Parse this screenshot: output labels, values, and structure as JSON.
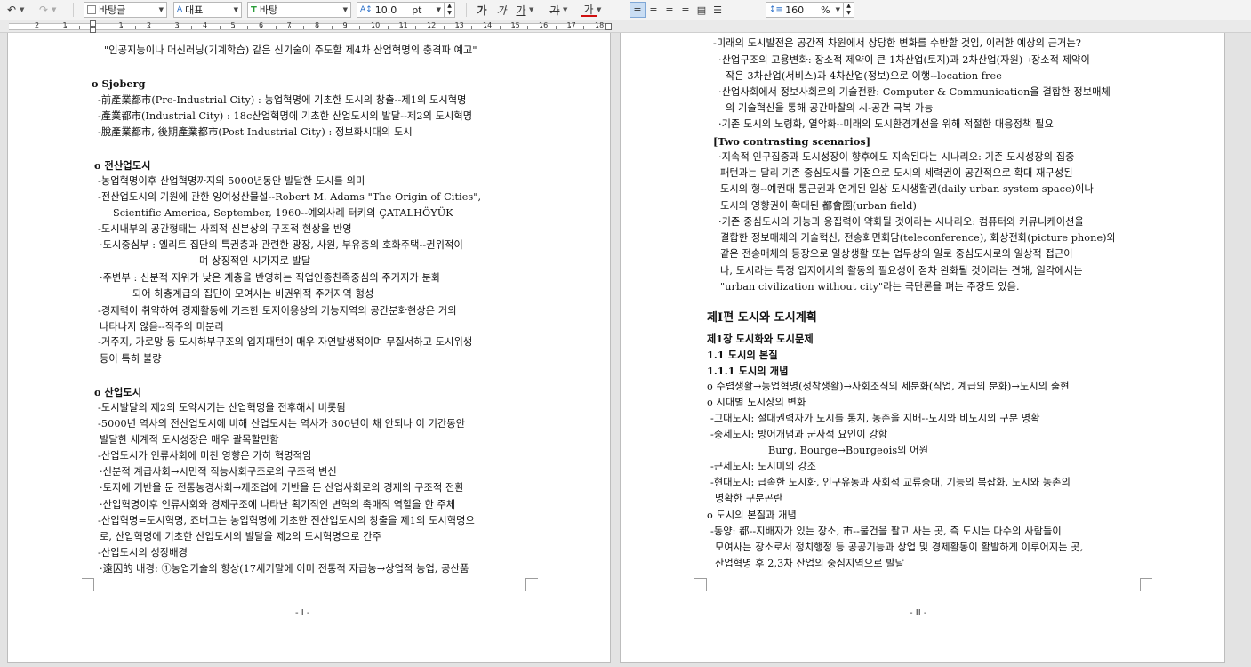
{
  "toolbar": {
    "undo_icon": "undo-icon",
    "redo_icon": "redo-icon",
    "style": "바탕글",
    "font_lang": "대표",
    "font_name": "바탕",
    "font_size": "10.0",
    "font_unit": "pt",
    "bold_label": "가",
    "italic_label": "가",
    "underline_label": "가",
    "strike_label": "가",
    "color_label": "가",
    "line_spacing": "160",
    "line_spacing_unit": "%"
  },
  "ruler": {
    "numbers": [
      "2",
      "1",
      "1",
      "2",
      "3",
      "4",
      "5",
      "6",
      "7",
      "8",
      "9",
      "10",
      "11",
      "12",
      "13",
      "14",
      "15",
      "16",
      "17",
      "18"
    ]
  },
  "page1": {
    "lines": [
      "\"인공지능이나 머신러닝(기계학습) 같은 신기술이 주도할 제4차 산업혁명의 충격파 예고\"",
      "o Sjoberg",
      "-前產業都市(Pre-Industrial City) : 농업혁명에 기초한 도시의 창출--제1의 도시혁명",
      "-產業都市(Industrial City) : 18c산업혁명에 기초한 산업도시의 발달--제2의 도시혁명",
      "-脫產業都市, 後期產業都市(Post Industrial City) : 정보화시대의 도시",
      "o 전산업도시",
      "-농업혁명이후 산업혁명까지의 5000년동안 발달한 도시를 의미",
      "-전산업도시의 기원에 관한 잉여생산물설--Robert M. Adams \"The Origin of Cities\",",
      "Scientific America, September, 1960--예외사례 터키의 ÇATALHÖYÜK",
      "-도시내부의 공간형태는 사회적 신분상의 구조적 현상을 반영",
      "·도시중심부 : 엘리트 집단의 특권층과 관련한 광장, 사원, 부유층의 호화주택--권위적이",
      "며 상징적인 시가지로 발달",
      "·주변부 : 신분적 지위가 낮은 계층을 반영하는 직업인종친족중심의 주거지가 분화",
      "되어 하층계급의 집단이 모여사는 비권위적 주거지역 형성",
      "-경제력이 취약하여 경제활동에 기초한 토지이용상의 기능지역의 공간분화현상은 거의",
      "나타나지 않음--직주의 미분리",
      "-거주지, 가로망 등 도시하부구조의 입지패턴이 매우 자연발생적이며 무질서하고 도시위생",
      "등이 특히 불량",
      "o 산업도시",
      "-도시발달의 제2의 도약시기는 산업혁명을 전후해서 비롯됨",
      "-5000년 역사의 전산업도시에 비해 산업도시는 역사가 300년이 채 안되나 이 기간동안",
      "발달한 세계적 도시성장은 매우 괄목할만함",
      "-산업도시가 인류사회에 미친 영향은 가히 혁명적임",
      "·신분적 계급사회→시민적 직능사회구조로의 구조적 변신",
      "·토지에 기반을 둔 전통농경사회→제조업에 기반을 둔 산업사회로의 경제의 구조적 전환",
      "·산업혁명이후 인류사회와 경제구조에 나타난 획기적인 변혁의 촉매적 역할을 한 주체",
      "-산업혁명=도시혁명, 죠버그는 농업혁명에 기초한 전산업도시의 창출을 제1의 도시혁명으",
      "로, 산업혁명에 기초한 산업도시의 발달을 제2의 도시혁명으로 간주",
      "-산업도시의 성장배경",
      "·遠因的 배경: ①농업기술의 향상(17세기말에 이미 전통적 자급농→상업적 농업, 공산품"
    ],
    "page_number": "- I -"
  },
  "page2": {
    "lines": [
      "-미래의 도시발전은 공간적 차원에서 상당한 변화를 수반할 것임, 이러한 예상의 근거는?",
      "·산업구조의 고용변화: 장소적 제약이 큰 1차산업(토지)과 2차산업(자원)→장소적 제약이",
      "작은 3차산업(서비스)과 4차산업(정보)으로 이행--location free",
      "·산업사회에서 정보사회로의 기술전환: Computer & Communication을 결합한 정보매체",
      "의 기술혁신을 통해 공간마찰의 시-공간 극복 가능",
      "·기존 도시의 노령화, 열악화--미래의 도시환경개선을 위해 적절한 대응정책 필요",
      "[Two contrasting scenarios]",
      "·지속적 인구집중과 도시성장이 향후에도 지속된다는 시나리오: 기존 도시성장의 집중",
      "패턴과는 달리 기존 중심도시를 기점으로 도시의 세력권이 공간적으로 확대 재구성된",
      "도시의 형--예컨대 통근권과 연계된 일상 도시생활권(daily urban system space)이나",
      "도시의 영향권이 확대된 都會圈(urban field)",
      "·기존 중심도시의 기능과 응집력이 약화될 것이라는 시나리오: 컴퓨터와 커뮤니케이션을",
      "결합한 정보매체의 기술혁신, 전송회면회담(teleconference), 화상전화(picture phone)와",
      "같은 전송매체의 등장으로 일상생활 또는 업무상의 일로 중심도시로의 일상적 접근이",
      "나, 도시라는 특정 입지에서의 활동의 필요성이 점차 완화될 것이라는 견해, 일각에서는",
      "\"urban civilization without city\"라는 극단론을 펴는 주장도 있음.",
      "제Ⅰ편 도시와 도시계획",
      "제1장 도시화와 도시문제",
      "1.1 도시의 본질",
      "1.1.1 도시의 개념",
      "o 수렵생활→농업혁명(정착생활)→사회조직의 세분화(직업, 계급의 분화)→도시의 출현",
      "o 시대별 도시상의 변화",
      "-고대도시: 절대권력자가 도시를 통치, 농촌을 지배--도시와 비도시의 구분 명확",
      "-중세도시: 방어개념과 군사적 요인이 강함",
      "Burg, Bourge→Bourgeois의 어원",
      "-근세도시: 도시미의 강조",
      "-현대도시: 급속한 도시화, 인구유동과 사회적 교류증대, 기능의 복잡화, 도시와 농촌의",
      "명확한 구분곤란",
      "o 도시의 본질과 개념",
      "-동양: 都--지배자가 있는 장소, 市--물건을 팔고 사는 곳, 즉 도시는 다수의 사람들이",
      "모여사는 장소로서 정치행정 등 공공기능과 상업 및 경제활동이 활발하게 이루어지는 곳,",
      "산업혁명 후 2,3차 산업의 중심지역으로 발달"
    ],
    "page_number": "- II -"
  }
}
